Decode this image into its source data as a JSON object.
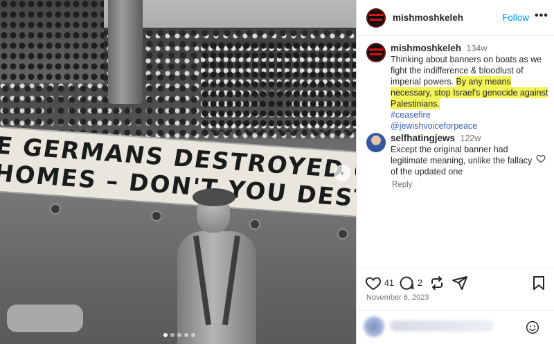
{
  "post": {
    "image_alt": "Black and white photo of a crowded ship with a banner",
    "banner_text": {
      "line1": "E GERMANS DESTROYED OUR FAMILIES",
      "line2": "HOMES – DON'T YOU DESTROY OUR HOPES"
    },
    "carousel_dots": 5,
    "carousel_active_index": 0
  },
  "header": {
    "username": "mishmoshkeleh",
    "follow_label": "Follow",
    "more_label": "•••"
  },
  "caption": {
    "username": "mishmoshkeleh",
    "age": "134w",
    "text_plain": "Thinking about banners on boats as we fight the indifference & bloodlust of imperial powers.",
    "text_highlight": "By any means necessary, stop Israel's genocide against Palestinians.",
    "hashtag": "#ceasefire",
    "mention": "@jewishvoiceforpeace",
    "highlight_color": "#f3f35a"
  },
  "comment": {
    "username": "selfhatingjews",
    "age": "122w",
    "text": "Except the original banner had legitimate meaning, unlike the fallacy of the updated one",
    "reply_label": "Reply"
  },
  "actions": {
    "like_icon": "heart-outline-icon",
    "likes_count": "41",
    "comment_icon": "speech-bubble-icon",
    "comments_count": "2",
    "repost_icon": "repost-icon",
    "share_icon": "paper-plane-icon",
    "save_icon": "bookmark-icon"
  },
  "date": "November 6, 2023",
  "colors": {
    "link": "#0095f6",
    "tag": "#3a5ec0",
    "muted": "#737373"
  }
}
